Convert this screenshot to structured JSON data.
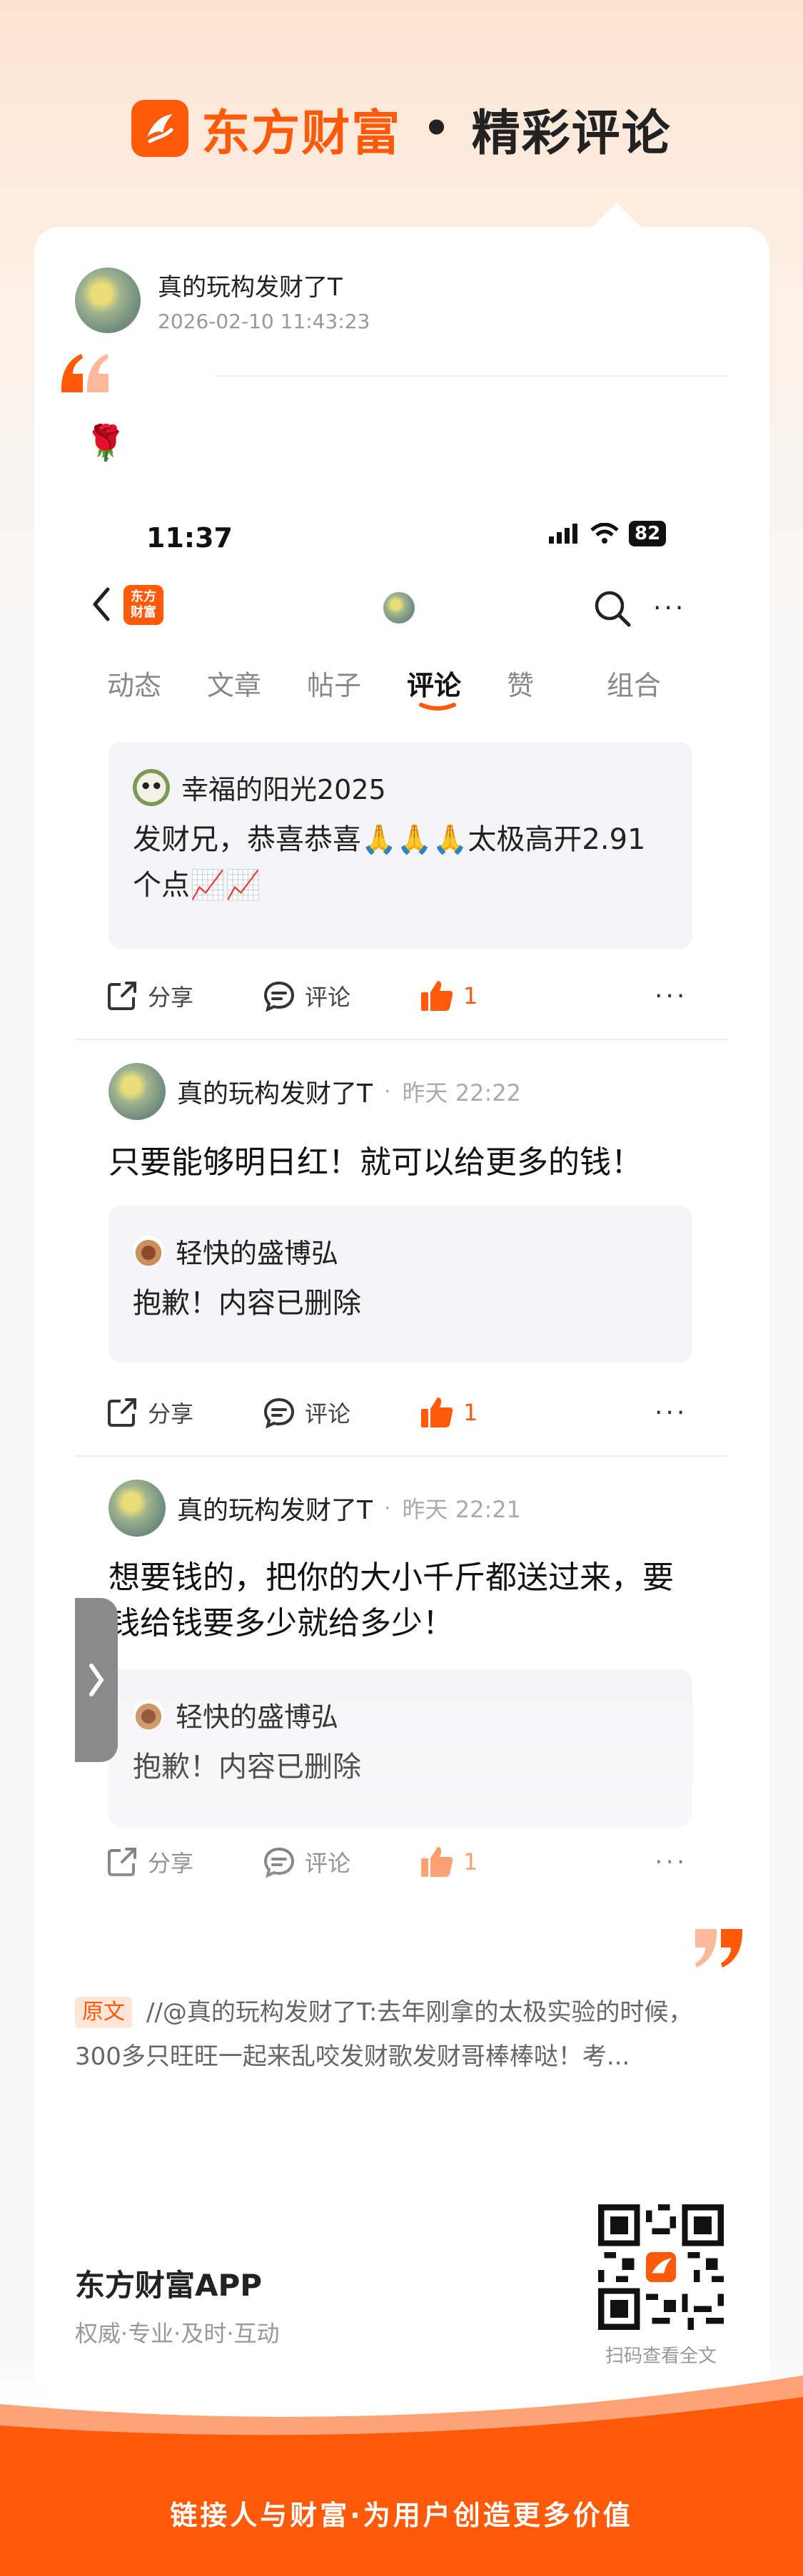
{
  "header": {
    "brand": "东方财富",
    "separator": "•",
    "tagline": "精彩评论"
  },
  "post": {
    "author": "真的玩构发财了T",
    "time": "2026-02-10 11:43:23",
    "emoji": "🌹"
  },
  "screenshot": {
    "status_time": "11:37",
    "battery": "82",
    "nav_logo": "东方\n财富",
    "tabs": [
      {
        "label": "动态"
      },
      {
        "label": "文章"
      },
      {
        "label": "帖子"
      },
      {
        "label": "评论",
        "active": true
      },
      {
        "label": "赞"
      },
      {
        "label": "组合"
      }
    ],
    "first_quote": {
      "user": "幸福的阳光2025",
      "text": "发财兄，恭喜恭喜🙏🙏🙏太极高开2.91个点📈📈"
    },
    "actions": {
      "share": "分享",
      "comment": "评论",
      "like_count": "1",
      "more": "···"
    },
    "comments": [
      {
        "author": "真的玩构发财了T",
        "dot": "·",
        "time": "昨天 22:22",
        "text": "只要能够明日红！就可以给更多的钱！",
        "quote_user": "轻快的盛博弘",
        "quote_text": "抱歉！内容已删除"
      },
      {
        "author": "真的玩构发财了T",
        "dot": "·",
        "time": "昨天 22:21",
        "text": "想要钱的，把你的大小千斤都送过来，要钱给钱要多少就给多少！",
        "quote_user": "轻快的盛博弘",
        "quote_text": "抱歉！内容已删除"
      }
    ],
    "side_handle": "❯"
  },
  "original": {
    "badge": "原文",
    "text": "//@真的玩构发财了T:去年刚拿的太极实验的时候，300多只旺旺一起来乱咬发财歌发财哥棒棒哒！考..."
  },
  "footer": {
    "app_name": "东方财富APP",
    "slogan": "权威·专业·及时·互动",
    "qr_hint": "扫码查看全文",
    "banner_text": "链接人与财富·为用户创造更多价值"
  },
  "colors": {
    "brand": "#ff5a0a",
    "text": "#222222",
    "muted": "#999999"
  }
}
